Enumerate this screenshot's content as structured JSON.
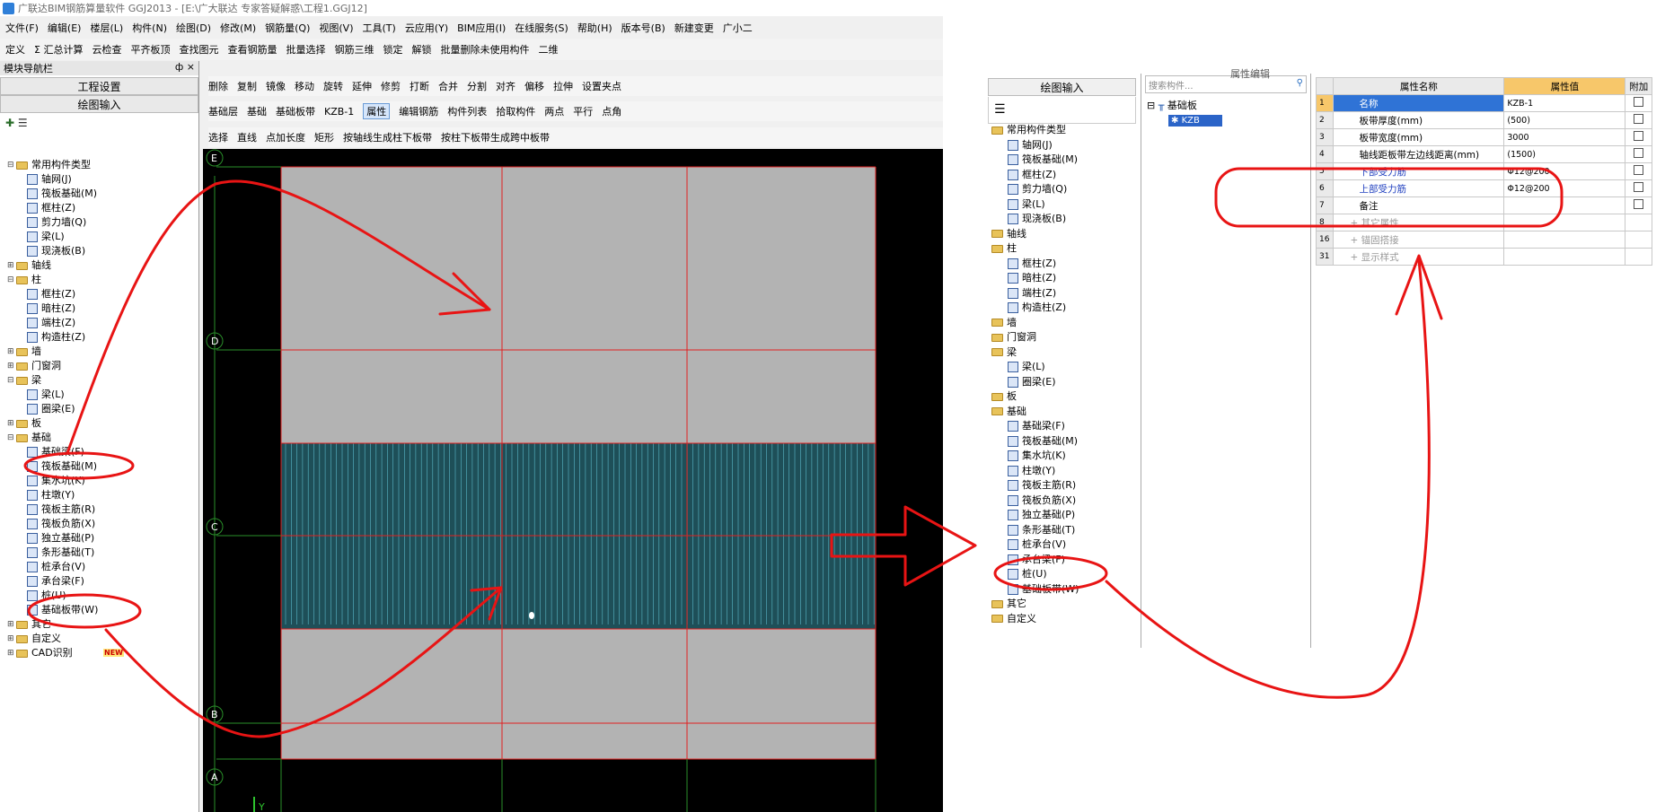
{
  "title_bar": {
    "text": "广联达BIM钢筋算量软件 GGJ2013 - [E:\\广大联达   专家答疑解惑\\工程1.GGJ12]"
  },
  "menu": [
    "文件(F)",
    "编辑(E)",
    "楼层(L)",
    "构件(N)",
    "绘图(D)",
    "修改(M)",
    "钢筋量(Q)",
    "视图(V)",
    "工具(T)",
    "云应用(Y)",
    "BIM应用(I)",
    "在线服务(S)",
    "帮助(H)",
    "版本号(B)",
    "新建变更",
    "广小二"
  ],
  "toolbar1": [
    "定义",
    "Σ 汇总计算",
    "云检查",
    "平齐板顶",
    "查找图元",
    "查看钢筋量",
    "批量选择",
    "钢筋三维",
    "锁定",
    "解锁",
    "批量删除未使用构件",
    "二维"
  ],
  "toolbar2": [
    "删除",
    "复制",
    "镜像",
    "移动",
    "旋转",
    "延伸",
    "修剪",
    "打断",
    "合并",
    "分割",
    "对齐",
    "偏移",
    "拉伸",
    "设置夹点"
  ],
  "toolbar3": [
    "基础层",
    "基础",
    "基础板带",
    "KZB-1",
    "属性",
    "编辑钢筋",
    "构件列表",
    "拾取构件",
    "两点",
    "平行",
    "点角"
  ],
  "toolbar4": [
    "选择",
    "直线",
    "点加长度",
    "矩形",
    "按轴线生成柱下板带",
    "按柱下板带生成跨中板带"
  ],
  "nav": {
    "title": "模块导航栏",
    "pin": "ф",
    "close": "×",
    "btn1": "工程设置",
    "btn2": "绘图输入"
  },
  "left_tree": [
    {
      "t": "常用构件类型",
      "l": 0,
      "k": "f",
      "x": "⊟"
    },
    {
      "t": "轴网(J)",
      "l": 1,
      "k": "i"
    },
    {
      "t": "筏板基础(M)",
      "l": 1,
      "k": "i"
    },
    {
      "t": "框柱(Z)",
      "l": 1,
      "k": "i"
    },
    {
      "t": "剪力墙(Q)",
      "l": 1,
      "k": "i"
    },
    {
      "t": "梁(L)",
      "l": 1,
      "k": "i"
    },
    {
      "t": "现浇板(B)",
      "l": 1,
      "k": "i"
    },
    {
      "t": "轴线",
      "l": 0,
      "k": "f",
      "x": "⊞"
    },
    {
      "t": "柱",
      "l": 0,
      "k": "f",
      "x": "⊟"
    },
    {
      "t": "框柱(Z)",
      "l": 1,
      "k": "i"
    },
    {
      "t": "暗柱(Z)",
      "l": 1,
      "k": "i"
    },
    {
      "t": "端柱(Z)",
      "l": 1,
      "k": "i"
    },
    {
      "t": "构造柱(Z)",
      "l": 1,
      "k": "i"
    },
    {
      "t": "墙",
      "l": 0,
      "k": "f",
      "x": "⊞"
    },
    {
      "t": "门窗洞",
      "l": 0,
      "k": "f",
      "x": "⊞"
    },
    {
      "t": "梁",
      "l": 0,
      "k": "f",
      "x": "⊟"
    },
    {
      "t": "梁(L)",
      "l": 1,
      "k": "i"
    },
    {
      "t": "圈梁(E)",
      "l": 1,
      "k": "i"
    },
    {
      "t": "板",
      "l": 0,
      "k": "f",
      "x": "⊞"
    },
    {
      "t": "基础",
      "l": 0,
      "k": "f",
      "x": "⊟"
    },
    {
      "t": "基础梁(F)",
      "l": 1,
      "k": "i"
    },
    {
      "t": "筏板基础(M)",
      "l": 1,
      "k": "i"
    },
    {
      "t": "集水坑(K)",
      "l": 1,
      "k": "i"
    },
    {
      "t": "柱墩(Y)",
      "l": 1,
      "k": "i"
    },
    {
      "t": "筏板主筋(R)",
      "l": 1,
      "k": "i"
    },
    {
      "t": "筏板负筋(X)",
      "l": 1,
      "k": "i"
    },
    {
      "t": "独立基础(P)",
      "l": 1,
      "k": "i"
    },
    {
      "t": "条形基础(T)",
      "l": 1,
      "k": "i"
    },
    {
      "t": "桩承台(V)",
      "l": 1,
      "k": "i"
    },
    {
      "t": "承台梁(F)",
      "l": 1,
      "k": "i"
    },
    {
      "t": "桩(U)",
      "l": 1,
      "k": "i"
    },
    {
      "t": "基础板带(W)",
      "l": 1,
      "k": "i"
    },
    {
      "t": "其它",
      "l": 0,
      "k": "f",
      "x": "⊞"
    },
    {
      "t": "自定义",
      "l": 0,
      "k": "f",
      "x": "⊞"
    },
    {
      "t": "CAD识别",
      "l": 0,
      "k": "f",
      "x": "⊞"
    }
  ],
  "new_badge": "NEW",
  "axes": [
    "E",
    "D",
    "C",
    "B",
    "A"
  ],
  "y_axis_label": "Y",
  "right_panel": {
    "tab": "绘图输入",
    "search_placeholder": "搜索构件...",
    "tree_root": "基础板",
    "tree_child": "KZB",
    "props_tab": "属性编辑"
  },
  "right_tree": [
    {
      "t": "常用构件类型",
      "l": 0,
      "k": "f"
    },
    {
      "t": "轴网(J)",
      "l": 1,
      "k": "i"
    },
    {
      "t": "筏板基础(M)",
      "l": 1,
      "k": "i"
    },
    {
      "t": "框柱(Z)",
      "l": 1,
      "k": "i"
    },
    {
      "t": "剪力墙(Q)",
      "l": 1,
      "k": "i"
    },
    {
      "t": "梁(L)",
      "l": 1,
      "k": "i"
    },
    {
      "t": "现浇板(B)",
      "l": 1,
      "k": "i"
    },
    {
      "t": "轴线",
      "l": 0,
      "k": "f"
    },
    {
      "t": "柱",
      "l": 0,
      "k": "f"
    },
    {
      "t": "框柱(Z)",
      "l": 1,
      "k": "i"
    },
    {
      "t": "暗柱(Z)",
      "l": 1,
      "k": "i"
    },
    {
      "t": "端柱(Z)",
      "l": 1,
      "k": "i"
    },
    {
      "t": "构造柱(Z)",
      "l": 1,
      "k": "i"
    },
    {
      "t": "墙",
      "l": 0,
      "k": "f"
    },
    {
      "t": "门窗洞",
      "l": 0,
      "k": "f"
    },
    {
      "t": "梁",
      "l": 0,
      "k": "f"
    },
    {
      "t": "梁(L)",
      "l": 1,
      "k": "i"
    },
    {
      "t": "圈梁(E)",
      "l": 1,
      "k": "i"
    },
    {
      "t": "板",
      "l": 0,
      "k": "f"
    },
    {
      "t": "基础",
      "l": 0,
      "k": "f"
    },
    {
      "t": "基础梁(F)",
      "l": 1,
      "k": "i"
    },
    {
      "t": "筏板基础(M)",
      "l": 1,
      "k": "i"
    },
    {
      "t": "集水坑(K)",
      "l": 1,
      "k": "i"
    },
    {
      "t": "柱墩(Y)",
      "l": 1,
      "k": "i"
    },
    {
      "t": "筏板主筋(R)",
      "l": 1,
      "k": "i"
    },
    {
      "t": "筏板负筋(X)",
      "l": 1,
      "k": "i"
    },
    {
      "t": "独立基础(P)",
      "l": 1,
      "k": "i"
    },
    {
      "t": "条形基础(T)",
      "l": 1,
      "k": "i"
    },
    {
      "t": "桩承台(V)",
      "l": 1,
      "k": "i"
    },
    {
      "t": "承台梁(F)",
      "l": 1,
      "k": "i"
    },
    {
      "t": "桩(U)",
      "l": 1,
      "k": "i"
    },
    {
      "t": "基础板带(W)",
      "l": 1,
      "k": "i"
    },
    {
      "t": "其它",
      "l": 0,
      "k": "f"
    },
    {
      "t": "自定义",
      "l": 0,
      "k": "f"
    }
  ],
  "properties": {
    "headers": [
      "属性名称",
      "属性值",
      "附加"
    ],
    "rows": [
      {
        "n": "1",
        "name": "名称",
        "val": "KZB-1",
        "blue": true,
        "sel": true
      },
      {
        "n": "2",
        "name": "板带厚度(mm)",
        "val": "(500)"
      },
      {
        "n": "3",
        "name": "板带宽度(mm)",
        "val": "3000"
      },
      {
        "n": "4",
        "name": "轴线距板带左边线距离(mm)",
        "val": "(1500)"
      },
      {
        "n": "5",
        "name": "下部受力筋",
        "val": "Φ12@200",
        "blue": true
      },
      {
        "n": "6",
        "name": "上部受力筋",
        "val": "Φ12@200",
        "blue": true
      },
      {
        "n": "7",
        "name": "备注",
        "val": ""
      },
      {
        "n": "8",
        "name": "其它属性",
        "val": "",
        "grp": true
      },
      {
        "n": "16",
        "name": "锚固搭接",
        "val": "",
        "grp": true
      },
      {
        "n": "31",
        "name": "显示样式",
        "val": "",
        "grp": true
      }
    ]
  }
}
